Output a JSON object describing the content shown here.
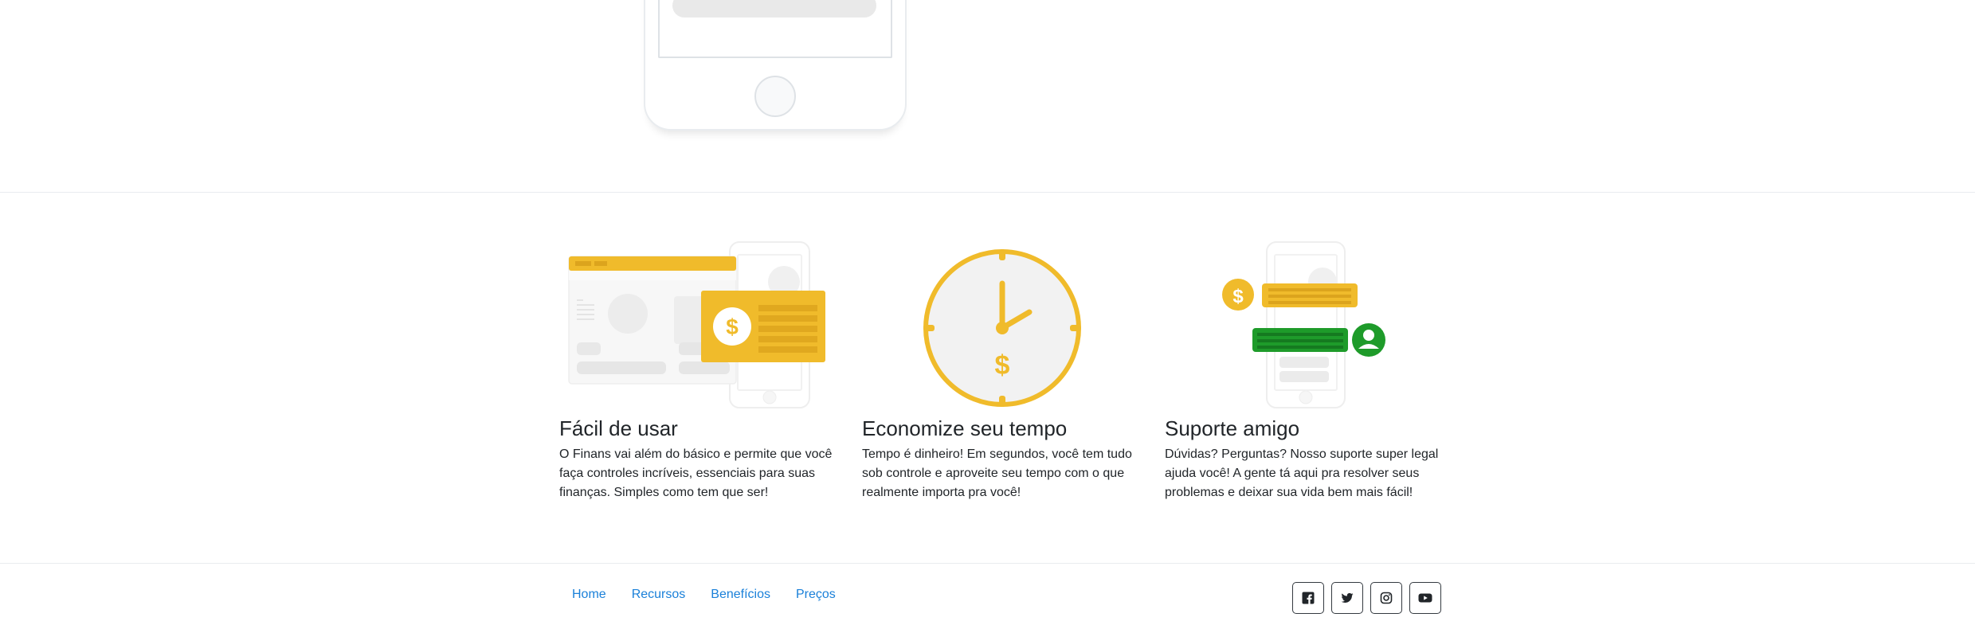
{
  "features": [
    {
      "title": "Fácil de usar",
      "text": "O Finans vai além do básico e permite que você faça controles incríveis, essenciais para suas finanças. Simples como tem que ser!",
      "icon": "dashboard-money-card-illustration"
    },
    {
      "title": "Economize seu tempo",
      "text": "Tempo é dinheiro! Em segundos, você tem tudo sob controle e aproveite seu tempo com o que realmente importa pra você!",
      "icon": "clock-dollar-illustration"
    },
    {
      "title": "Suporte amigo",
      "text": "Dúvidas? Perguntas? Nosso suporte super legal ajuda você! A gente tá aqui pra resolver seus problemas e deixar sua vida bem mais fácil!",
      "icon": "phone-chat-support-illustration"
    }
  ],
  "footer": {
    "nav": [
      "Home",
      "Recursos",
      "Benefícios",
      "Preços"
    ],
    "social": [
      "facebook-icon",
      "twitter-icon",
      "instagram-icon",
      "youtube-icon"
    ]
  },
  "colors": {
    "accent_yellow": "#f0bb2b",
    "accent_green": "#1e9b2a",
    "link": "#1a80d9",
    "text": "#212529"
  }
}
